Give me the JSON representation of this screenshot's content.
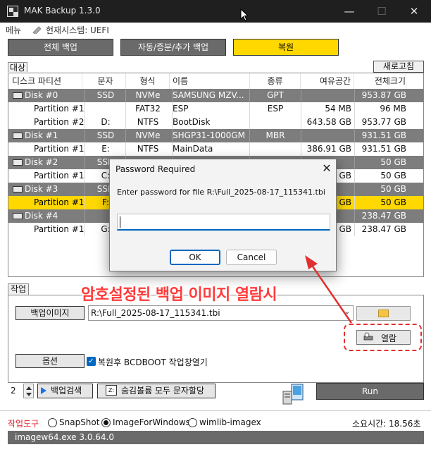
{
  "window": {
    "title": "MAK Backup 1.3.0"
  },
  "menu": {
    "item": "메뉴",
    "system_label": "현재시스템: UEFI"
  },
  "modes": {
    "full": "전체 백업",
    "auto": "자동/증분/추가 백업",
    "restore": "복원"
  },
  "target": {
    "label": "대상",
    "refresh": "새로고침",
    "headers": [
      "디스크 파티션",
      "문자",
      "형식",
      "이름",
      "종류",
      "여유공간",
      "전체크기"
    ],
    "rows": [
      {
        "kind": "disk",
        "c0": "Disk #0",
        "c1": "SSD",
        "c2": "NVMe",
        "c3": "SAMSUNG MZV...",
        "c4": "GPT",
        "c5": "",
        "c6": "953.87 GB"
      },
      {
        "kind": "part",
        "c0": "Partition #1",
        "c1": "",
        "c2": "FAT32",
        "c3": "ESP",
        "c4": "ESP",
        "c5": "54 MB",
        "c6": "96 MB"
      },
      {
        "kind": "part",
        "c0": "Partition #2",
        "c1": "D:",
        "c2": "NTFS",
        "c3": "BootDisk",
        "c4": "",
        "c5": "643.58 GB",
        "c6": "953.77 GB"
      },
      {
        "kind": "disk",
        "c0": "Disk #1",
        "c1": "SSD",
        "c2": "NVMe",
        "c3": "SHGP31-1000GM",
        "c4": "MBR",
        "c5": "",
        "c6": "931.51 GB"
      },
      {
        "kind": "part",
        "c0": "Partition #1",
        "c1": "E:",
        "c2": "NTFS",
        "c3": "MainData",
        "c4": "",
        "c5": "386.91 GB",
        "c6": "931.51 GB"
      },
      {
        "kind": "disk",
        "c0": "Disk #2",
        "c1": "SSD",
        "c2": "",
        "c3": "",
        "c4": "",
        "c5": "",
        "c6": "50 GB"
      },
      {
        "kind": "part",
        "c0": "Partition #1",
        "c1": "C:",
        "c2": "",
        "c3": "",
        "c4": "",
        "c5": "GB",
        "c6": "50 GB"
      },
      {
        "kind": "disk",
        "c0": "Disk #3",
        "c1": "SSD",
        "c2": "",
        "c3": "",
        "c4": "",
        "c5": "",
        "c6": "50 GB"
      },
      {
        "kind": "sel",
        "c0": "Partition #1",
        "c1": "F:",
        "c2": "",
        "c3": "",
        "c4": "",
        "c5": "GB",
        "c6": "50 GB"
      },
      {
        "kind": "disk",
        "c0": "Disk #4",
        "c1": "",
        "c2": "",
        "c3": "",
        "c4": "",
        "c5": "",
        "c6": "238.47 GB"
      },
      {
        "kind": "part",
        "c0": "Partition #1",
        "c1": "G:",
        "c2": "",
        "c3": "",
        "c4": "",
        "c5": "GB",
        "c6": "238.47 GB"
      }
    ]
  },
  "dialog": {
    "title": "Password Required",
    "prompt": "Enter password for file R:\\Full_2025-08-17_115341.tbi",
    "input_value": "",
    "ok": "OK",
    "cancel": "Cancel"
  },
  "work": {
    "label": "작업",
    "backup_image_btn": "백업이미지",
    "path": "R:\\Full_2025-08-17_115341.tbi",
    "view_btn": "열람",
    "options_btn": "옵션",
    "bcd_label": "복원후 BCDBOOT 작업창열기",
    "bcd_checked": true
  },
  "annotation": {
    "text": "암호설정된 백업 이미지 열람시",
    "color": "#ff3b3b"
  },
  "controls": {
    "spin_value": "2",
    "search_btn": "백업검색",
    "assign_btn": "숨김볼륨 모두 문자할당",
    "run_btn": "Run"
  },
  "tools": {
    "label": "작업도구",
    "options": [
      {
        "label": "SnapShot",
        "selected": false
      },
      {
        "label": "ImageForWindows",
        "selected": true
      },
      {
        "label": "wimlib-imagex",
        "selected": false
      }
    ],
    "elapsed": "소요시간: 18.56초"
  },
  "status": {
    "text": "imagew64.exe 3.0.64.0"
  },
  "colors": {
    "accent_yellow": "#ffd800",
    "dark_gray": "#6a6a6a",
    "dialog_blue": "#0067c0",
    "annotation_red": "#ff3b3b"
  }
}
